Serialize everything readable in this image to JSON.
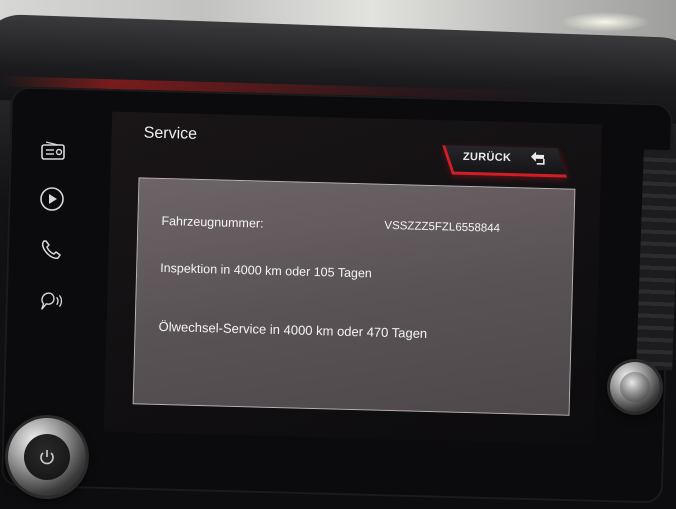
{
  "screen": {
    "title": "Service",
    "back_button_label": "ZURÜCK"
  },
  "side_controls": {
    "icons": [
      "radio-icon",
      "play-icon",
      "phone-icon",
      "voice-icon"
    ]
  },
  "info_panel": {
    "vehicle_number_label": "Fahrzeugnummer:",
    "vehicle_number_value": "VSSZZZ5FZL6558844",
    "inspection_text": "Inspektion in 4000 km oder 105 Tagen",
    "oil_service_text": "Ölwechsel-Service in 4000 km oder 470 Tagen"
  },
  "colors": {
    "accent_red": "#d01e25",
    "panel_bg": "#5c5558",
    "screen_bg": "#110f11",
    "text": "#f4f4f4"
  }
}
